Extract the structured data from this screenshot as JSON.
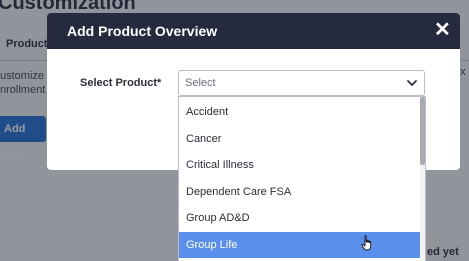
{
  "background": {
    "title": "Customization",
    "tab": "Product",
    "text_line1": "ustomize t",
    "text_line2": "nrollment",
    "right_text": "ex",
    "button_label": "Add Pro",
    "bottom_text": "ed yet"
  },
  "modal": {
    "title": "Add Product Overview",
    "close_label": "✕",
    "field_label": "Select Product*",
    "select_value": "Select"
  },
  "dropdown": {
    "options": [
      "Accident",
      "Cancer",
      "Critical Illness",
      "Dependent Care FSA",
      "Group AD&D",
      "Group Life"
    ],
    "highlighted": "Group Life"
  },
  "colors": {
    "header_bg": "#262a3f",
    "highlight": "#5b8fec",
    "primary_button": "#1a6dd6"
  }
}
